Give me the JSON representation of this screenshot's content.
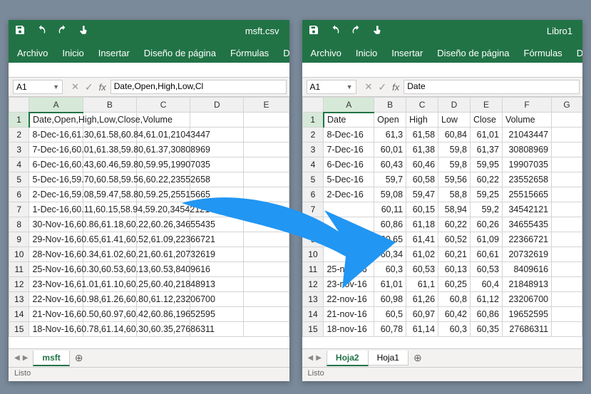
{
  "menus": {
    "archivo": "Archivo",
    "inicio": "Inicio",
    "insertar": "Insertar",
    "diseno": "Diseño de página",
    "formulas": "Fórmulas",
    "datos": "Dat",
    "datos_short": "Dato"
  },
  "status": "Listo",
  "fx": {
    "label": "fx"
  },
  "left": {
    "filename": "msft.csv",
    "namebox": "A1",
    "formula": "Date,Open,High,Low,Cl",
    "sheet_tab": "msft",
    "add_tab": "⊕",
    "cols": [
      "A",
      "B",
      "C",
      "D",
      "E"
    ],
    "rows": [
      [
        "Date,Open,High,Low,Close,Volume",
        "",
        "",
        "",
        ""
      ],
      [
        "8-Dec-16,61.30,61.58,60.84,61.01,21043447",
        "",
        "",
        "",
        ""
      ],
      [
        "7-Dec-16,60.01,61.38,59.80,61.37,30808969",
        "",
        "",
        "",
        ""
      ],
      [
        "6-Dec-16,60.43,60.46,59.80,59.95,19907035",
        "",
        "",
        "",
        ""
      ],
      [
        "5-Dec-16,59.70,60.58,59.56,60.22,23552658",
        "",
        "",
        "",
        ""
      ],
      [
        "2-Dec-16,59.08,59.47,58.80,59.25,25515665",
        "",
        "",
        "",
        ""
      ],
      [
        "1-Dec-16,60.11,60.15,58.94,59.20,34542121",
        "",
        "",
        "",
        ""
      ],
      [
        "30-Nov-16,60.86,61.18,60.22,60.26,34655435",
        "",
        "",
        "",
        ""
      ],
      [
        "29-Nov-16,60.65,61.41,60.52,61.09,22366721",
        "",
        "",
        "",
        ""
      ],
      [
        "28-Nov-16,60.34,61.02,60.21,60.61,20732619",
        "",
        "",
        "",
        ""
      ],
      [
        "25-Nov-16,60.30,60.53,60.13,60.53,8409616",
        "",
        "",
        "",
        ""
      ],
      [
        "23-Nov-16,61.01,61.10,60.25,60.40,21848913",
        "",
        "",
        "",
        ""
      ],
      [
        "22-Nov-16,60.98,61.26,60.80,61.12,23206700",
        "",
        "",
        "",
        ""
      ],
      [
        "21-Nov-16,60.50,60.97,60.42,60.86,19652595",
        "",
        "",
        "",
        ""
      ],
      [
        "18-Nov-16,60.78,61.14,60.30,60.35,27686311",
        "",
        "",
        "",
        ""
      ]
    ]
  },
  "right": {
    "filename": "Libro1",
    "namebox": "A1",
    "formula": "Date",
    "sheet_tab_active": "Hoja2",
    "sheet_tab_other": "Hoja1",
    "add_tab": "⊕",
    "cols": [
      "A",
      "B",
      "C",
      "D",
      "E",
      "F",
      "G"
    ],
    "header_row": [
      "Date",
      "Open",
      "High",
      "Low",
      "Close",
      "Volume",
      ""
    ],
    "rows": [
      [
        "8-Dec-16",
        "61,3",
        "61,58",
        "60,84",
        "61,01",
        "21043447",
        ""
      ],
      [
        "7-Dec-16",
        "60,01",
        "61,38",
        "59,8",
        "61,37",
        "30808969",
        ""
      ],
      [
        "6-Dec-16",
        "60,43",
        "60,46",
        "59,8",
        "59,95",
        "19907035",
        ""
      ],
      [
        "5-Dec-16",
        "59,7",
        "60,58",
        "59,56",
        "60,22",
        "23552658",
        ""
      ],
      [
        "2-Dec-16",
        "59,08",
        "59,47",
        "58,8",
        "59,25",
        "25515665",
        ""
      ],
      [
        "",
        "60,11",
        "60,15",
        "58,94",
        "59,2",
        "34542121",
        ""
      ],
      [
        "",
        "60,86",
        "61,18",
        "60,22",
        "60,26",
        "34655435",
        ""
      ],
      [
        "",
        "60,65",
        "61,41",
        "60,52",
        "61,09",
        "22366721",
        ""
      ],
      [
        "",
        "60,34",
        "61,02",
        "60,21",
        "60,61",
        "20732619",
        ""
      ],
      [
        "25-nov-16",
        "60,3",
        "60,53",
        "60,13",
        "60,53",
        "8409616",
        ""
      ],
      [
        "23-nov-16",
        "61,01",
        "61,1",
        "60,25",
        "60,4",
        "21848913",
        ""
      ],
      [
        "22-nov-16",
        "60,98",
        "61,26",
        "60,8",
        "61,12",
        "23206700",
        ""
      ],
      [
        "21-nov-16",
        "60,5",
        "60,97",
        "60,42",
        "60,86",
        "19652595",
        ""
      ],
      [
        "18-nov-16",
        "60,78",
        "61,14",
        "60,3",
        "60,35",
        "27686311",
        ""
      ]
    ]
  }
}
